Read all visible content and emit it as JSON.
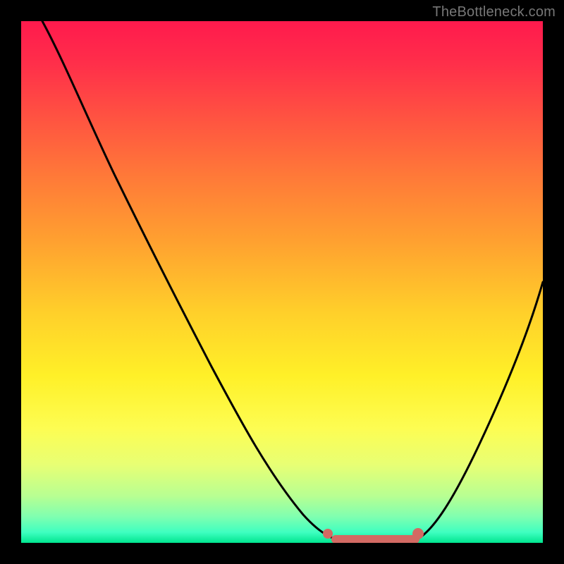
{
  "watermark": "TheBottleneck.com",
  "colors": {
    "background": "#000000",
    "curve_stroke": "#000000",
    "marker_stroke": "#d36a63",
    "gradient_top": "#ff1a4d",
    "gradient_mid": "#fff028",
    "gradient_bottom": "#00e58f"
  },
  "chart_data": {
    "type": "line",
    "title": "",
    "xlabel": "",
    "ylabel": "",
    "xlim": [
      0,
      100
    ],
    "ylim": [
      0,
      100
    ],
    "grid": false,
    "legend": false,
    "series": [
      {
        "name": "bottleneck-curve",
        "x": [
          4,
          10,
          18,
          26,
          34,
          42,
          50,
          56,
          60,
          64,
          68,
          72,
          76,
          82,
          88,
          94,
          100
        ],
        "values": [
          100,
          90,
          77,
          64,
          51,
          38,
          25,
          13,
          6,
          2,
          0,
          0,
          0,
          8,
          20,
          34,
          50
        ]
      }
    ],
    "markers": {
      "name": "optimal-range",
      "x": [
        60,
        64,
        68,
        72,
        76
      ],
      "values": [
        2,
        1,
        0.5,
        0.5,
        1.5
      ]
    }
  }
}
